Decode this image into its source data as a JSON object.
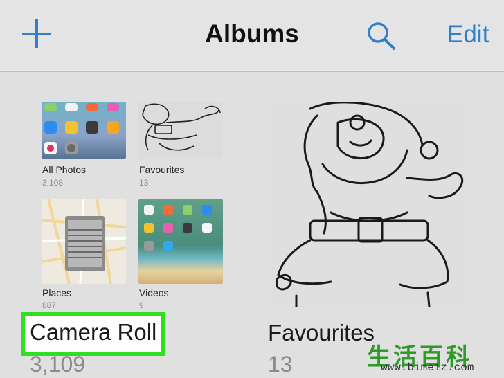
{
  "navbar": {
    "title": "Albums",
    "edit_label": "Edit",
    "add_icon": "plus-icon",
    "search_icon": "magnifier-icon"
  },
  "albums_grid": [
    {
      "name": "All Photos",
      "count": "3,108"
    },
    {
      "name": "Favourites",
      "count": "13"
    },
    {
      "name": "Places",
      "count": "887"
    },
    {
      "name": "Videos",
      "count": "9"
    }
  ],
  "large_albums": [
    {
      "name": "Camera Roll",
      "count": "3,109"
    },
    {
      "name": "Favourites",
      "count": "13"
    }
  ],
  "watermark": {
    "chars": "生活百科",
    "url": "www.bimeiz.com"
  },
  "colors": {
    "accent": "#2f80c8",
    "highlight": "#2ee01f",
    "background": "#e0e0e0"
  }
}
